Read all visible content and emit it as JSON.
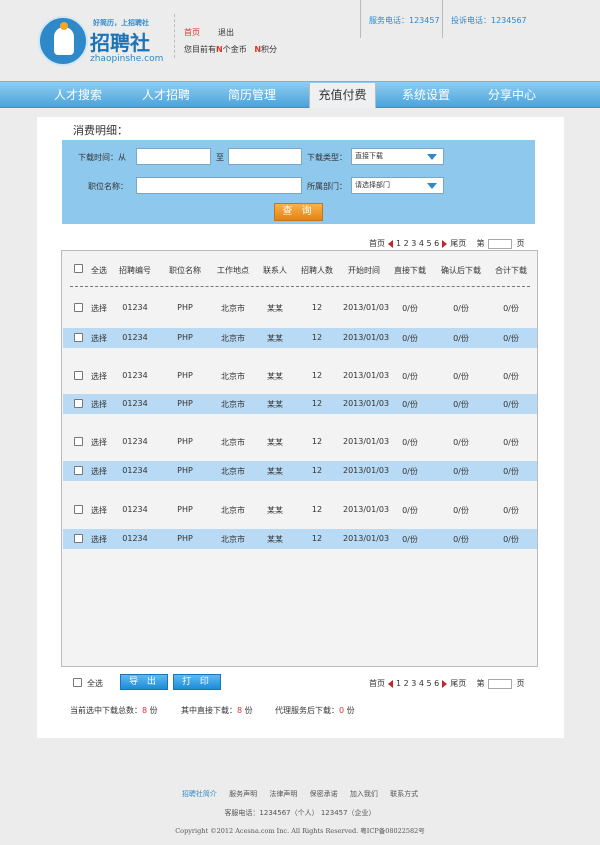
{
  "header": {
    "logo": {
      "ring_text": "WWW.ZHAOPINSHE.COM",
      "slogan": "好简历，上招聘社",
      "name": "招聘社",
      "domain": "zhaopinshe.com"
    },
    "home_link": "首页",
    "exit_link": "退出",
    "balance_prefix": "您目前有",
    "balance_coin_count": "N",
    "balance_coin_unit": "个金币",
    "balance_point_count": "N",
    "balance_point_unit": "积分",
    "phone": "服务电话：123457",
    "complaint": "投诉电话：1234567"
  },
  "nav": {
    "items": [
      "人才搜索",
      "人才招聘",
      "简历管理",
      "充值付费",
      "系统设置",
      "分享中心"
    ],
    "active_index": 3
  },
  "main": {
    "section_title": "消费明细：",
    "filter": {
      "download_time_label": "下载时间：从",
      "to_label": "至",
      "download_type_label": "下载类型：",
      "download_type_value": "直接下载",
      "position_label": "职位名称：",
      "department_label": "所属部门：",
      "department_value": "请选择部门",
      "query_button": "查 询"
    },
    "pager": {
      "first": "首页",
      "pages": "1 2 3 4 5 6",
      "last": "尾页",
      "page_prefix": "第",
      "page_suffix": "页"
    },
    "table": {
      "select_all": "全选",
      "headers": [
        "招聘编号",
        "职位名称",
        "工作地点",
        "联系人",
        "招聘人数",
        "开始时间",
        "直接下载",
        "确认后下载",
        "合计下载"
      ],
      "rows": [
        {
          "select": "选择",
          "id": "01234",
          "position": "PHP",
          "location": "北京市",
          "contact": "某某",
          "count": "12",
          "start": "2013/01/03",
          "direct": "0/份",
          "confirmed": "0/份",
          "total": "0/份",
          "highlight": false
        },
        {
          "select": "选择",
          "id": "01234",
          "position": "PHP",
          "location": "北京市",
          "contact": "某某",
          "count": "12",
          "start": "2013/01/03",
          "direct": "0/份",
          "confirmed": "0/份",
          "total": "0/份",
          "highlight": true
        },
        {
          "select": "选择",
          "id": "01234",
          "position": "PHP",
          "location": "北京市",
          "contact": "某某",
          "count": "12",
          "start": "2013/01/03",
          "direct": "0/份",
          "confirmed": "0/份",
          "total": "0/份",
          "highlight": false
        },
        {
          "select": "选择",
          "id": "01234",
          "position": "PHP",
          "location": "北京市",
          "contact": "某某",
          "count": "12",
          "start": "2013/01/03",
          "direct": "0/份",
          "confirmed": "0/份",
          "total": "0/份",
          "highlight": true
        },
        {
          "select": "选择",
          "id": "01234",
          "position": "PHP",
          "location": "北京市",
          "contact": "某某",
          "count": "12",
          "start": "2013/01/03",
          "direct": "0/份",
          "confirmed": "0/份",
          "total": "0/份",
          "highlight": false
        },
        {
          "select": "选择",
          "id": "01234",
          "position": "PHP",
          "location": "北京市",
          "contact": "某某",
          "count": "12",
          "start": "2013/01/03",
          "direct": "0/份",
          "confirmed": "0/份",
          "total": "0/份",
          "highlight": true
        },
        {
          "select": "选择",
          "id": "01234",
          "position": "PHP",
          "location": "北京市",
          "contact": "某某",
          "count": "12",
          "start": "2013/01/03",
          "direct": "0/份",
          "confirmed": "0/份",
          "total": "0/份",
          "highlight": false
        },
        {
          "select": "选择",
          "id": "01234",
          "position": "PHP",
          "location": "北京市",
          "contact": "某某",
          "count": "12",
          "start": "2013/01/03",
          "direct": "0/份",
          "confirmed": "0/份",
          "total": "0/份",
          "highlight": true
        }
      ]
    },
    "bottom": {
      "select_all": "全选",
      "export_button": "导 出",
      "print_button": "打 印",
      "total_label": "当前选中下载总数：",
      "total_value": "8",
      "direct_label": "其中直接下载：",
      "direct_value": "8",
      "agent_label": "代理服务后下载：",
      "agent_value": "0",
      "unit": "份"
    }
  },
  "footer": {
    "links": [
      "招聘社简介",
      "服务声明",
      "法律声明",
      "保密承诺",
      "加入我们",
      "联系方式"
    ],
    "service": "客服电话：1234567（个人） 123457（企业）",
    "copyright": "Copyright ©2012 Acesna.com Inc. All Rights Reserved. 粤ICP备08022582号"
  },
  "colors": {
    "brand_blue": "#2f88c8",
    "nav_top": "#8fcdf0",
    "nav_bottom": "#4aa3dc",
    "filter_bg": "#8ec8ec",
    "row_highlight": "#b9daf4",
    "query_orange": "#e48316",
    "accent_red": "#d9362b"
  }
}
